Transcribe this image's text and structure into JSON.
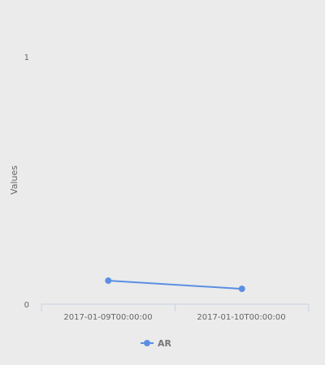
{
  "chart_data": {
    "type": "line",
    "categories": [
      "2017-01-09T00:00:00",
      "2017-01-10T00:00:00"
    ],
    "series": [
      {
        "name": "AR",
        "values": [
          0.095,
          0.062
        ]
      }
    ],
    "ylabel": "Values",
    "ylim": [
      0,
      1
    ],
    "yticks": [
      "0",
      "1"
    ],
    "legend_position": "bottom",
    "grid": false,
    "colors": {
      "background": "#ebebeb",
      "series": "#5b8fe3",
      "axis": "#c8d2e6",
      "text": "#666666",
      "legend_text": "#777777"
    }
  }
}
